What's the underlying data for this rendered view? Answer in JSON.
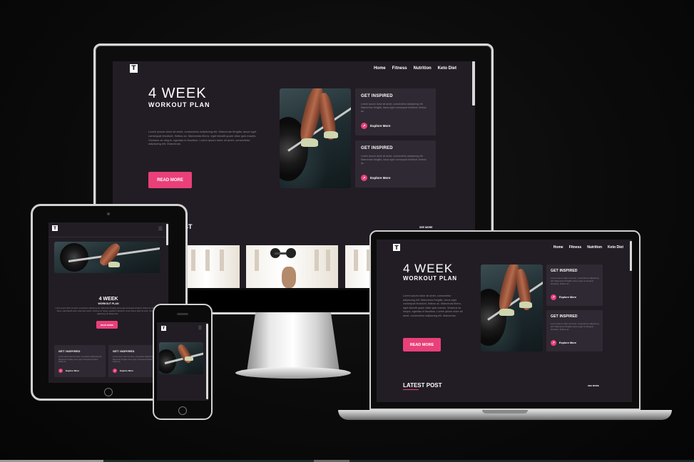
{
  "brand": {
    "logo_glyph": "T",
    "accent": "#e9407a",
    "bg": "#221d24",
    "card_bg": "#2f2933"
  },
  "nav": {
    "items": [
      "Home",
      "Fitness",
      "Nutrition",
      "Keto Diet"
    ]
  },
  "hero": {
    "title": "4 WEEK",
    "subtitle": "WORKOUT PLAN",
    "body": "Lorem ipsum dolor sit amet, consectetur adipiscing elit. Maecenas fringilla, lacus eget consequat tincidunt, finibus ac. Maecenas libero, eget blandit quam vitae quis mauris. Vivamus ac neque, egestas in faucibus. Lorem ipsum dolor sit amet, consectetur adipiscing elit. Maecenas.",
    "cta": "READ MORE"
  },
  "cards": [
    {
      "title": "GET INSPIRED",
      "body": "Lorem ipsum dolor sit amet, consectetur adipiscing elit. Maecenas fringilla, lacus eget consequat tincidunt, finibus ac.",
      "link": "Explore More"
    },
    {
      "title": "GET INSPIRED",
      "body": "Lorem ipsum dolor sit amet, consectetur adipiscing elit. Maecenas fringilla, lacus eget consequat tincidunt, finibus ac.",
      "link": "Explore More"
    }
  ],
  "latest": {
    "title": "LATEST POST",
    "title_partial": "ST",
    "see_more": "SEE MORE"
  },
  "icons": {
    "menu": "hamburger-icon",
    "arrow": "arrow-icon"
  }
}
